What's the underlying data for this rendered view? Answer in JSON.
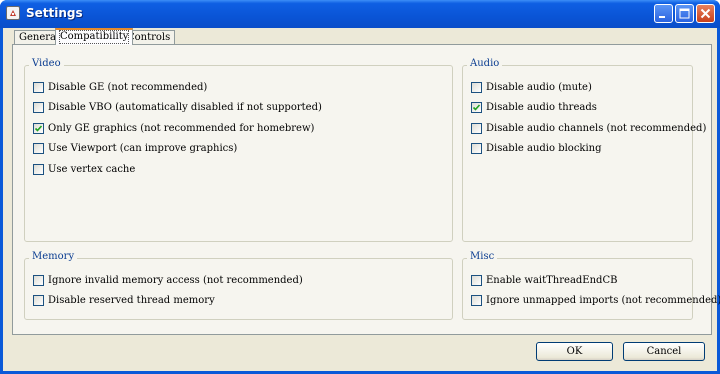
{
  "window": {
    "title": "Settings"
  },
  "tabs": [
    {
      "label": "General",
      "active": false
    },
    {
      "label": "Compatibility",
      "active": true
    },
    {
      "label": "Controls",
      "active": false
    }
  ],
  "video": {
    "title": "Video",
    "items": [
      {
        "label": "Disable GE (not recommended)",
        "checked": false
      },
      {
        "label": "Disable VBO (automatically disabled if not supported)",
        "checked": false
      },
      {
        "label": "Only GE graphics (not recommended for homebrew)",
        "checked": true
      },
      {
        "label": "Use Viewport (can improve graphics)",
        "checked": false
      },
      {
        "label": "Use vertex cache",
        "checked": false
      }
    ]
  },
  "audio": {
    "title": "Audio",
    "items": [
      {
        "label": "Disable audio (mute)",
        "checked": false
      },
      {
        "label": "Disable audio threads",
        "checked": true
      },
      {
        "label": "Disable audio channels (not recommended)",
        "checked": false
      },
      {
        "label": "Disable audio blocking",
        "checked": false
      }
    ]
  },
  "memory": {
    "title": "Memory",
    "items": [
      {
        "label": "Ignore invalid memory access (not recommended)",
        "checked": false
      },
      {
        "label": "Disable reserved thread memory",
        "checked": false
      }
    ]
  },
  "misc": {
    "title": "Misc",
    "items": [
      {
        "label": "Enable waitThreadEndCB",
        "checked": false
      },
      {
        "label": "Ignore unmapped imports (not recommended)",
        "checked": false
      }
    ]
  },
  "buttons": {
    "ok": "OK",
    "cancel": "Cancel"
  }
}
